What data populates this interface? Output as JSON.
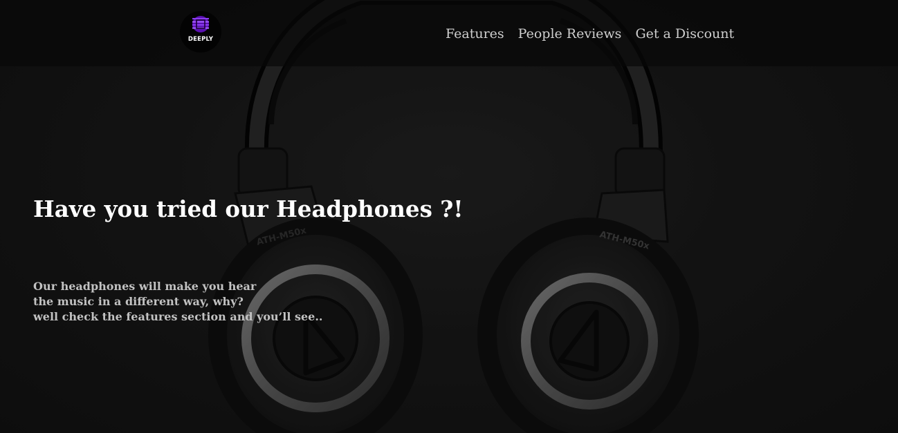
{
  "brand": {
    "logo_text": "DEEPLY",
    "logo_icon": "striped-orb-logo-icon",
    "accent_color": "#7a1fd6"
  },
  "nav": {
    "links": [
      {
        "label": "Features"
      },
      {
        "label": "People Reviews"
      },
      {
        "label": "Get a Discount"
      }
    ]
  },
  "hero": {
    "title": "Have you tried our Headphones ?!",
    "description_lines": [
      "Our headphones will make you hear",
      "the music in a different way, why?",
      "well check the features section and you’ll see.."
    ],
    "image": {
      "icon": "headphones-icon",
      "ear_cup_label": "ATH-M50x"
    }
  },
  "colors": {
    "background": "#151515",
    "navbar": "#080808",
    "title": "#ffffff",
    "body_text": "#c2c2c2",
    "nav_text": "#cfcfcf"
  }
}
